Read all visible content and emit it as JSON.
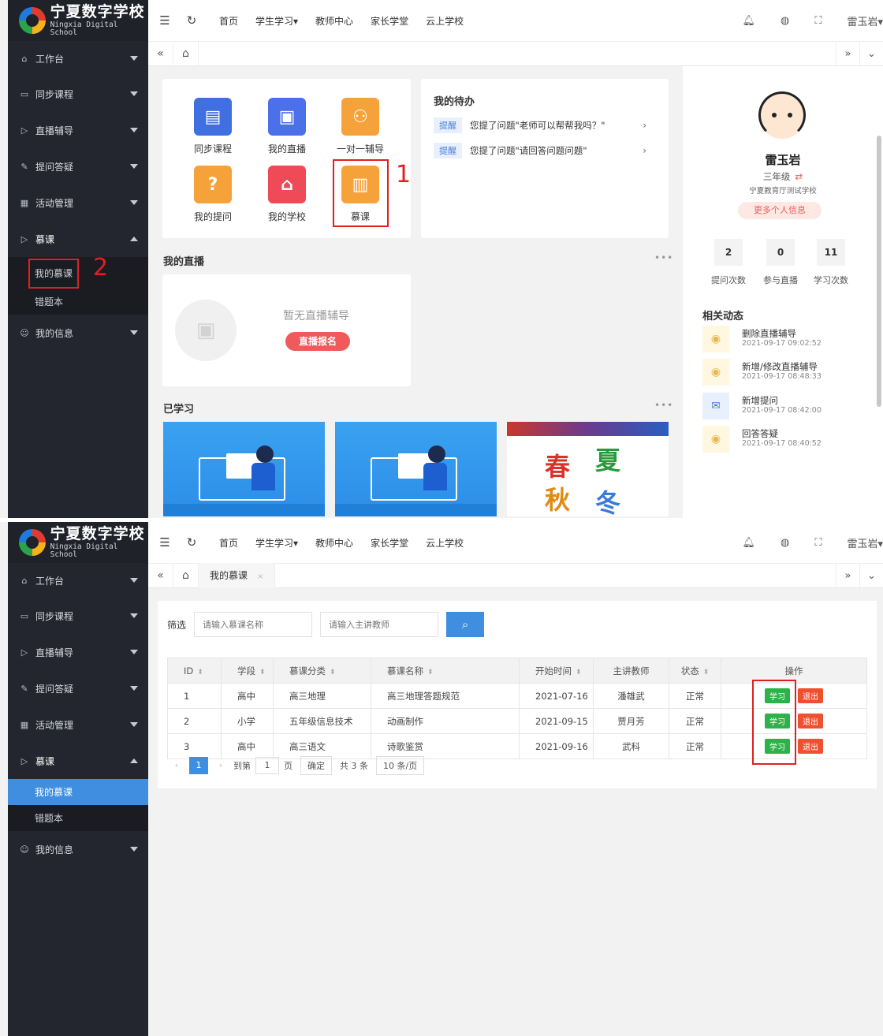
{
  "brand": {
    "name_cn": "宁夏数字学校",
    "name_en": "Ningxia Digital School"
  },
  "topnav": {
    "links": [
      "首页",
      "学生学习▾",
      "教师中心",
      "家长学堂",
      "云上学校"
    ],
    "user": "雷玉岩▾"
  },
  "sidebar": {
    "items": [
      {
        "label": "工作台",
        "icon": "home-icon"
      },
      {
        "label": "同步课程",
        "icon": "book-icon"
      },
      {
        "label": "直播辅导",
        "icon": "play-icon"
      },
      {
        "label": "提问答疑",
        "icon": "edit-icon"
      },
      {
        "label": "活动管理",
        "icon": "grid-icon"
      },
      {
        "label": "慕课",
        "icon": "play-icon"
      }
    ],
    "mooc_sub": [
      "我的慕课",
      "错题本"
    ],
    "info": "我的信息"
  },
  "shot1": {
    "apps": [
      "同步课程",
      "我的直播",
      "一对一辅导",
      "我的提问",
      "我的学校",
      "慕课"
    ],
    "todo": {
      "title": "我的待办",
      "items": [
        {
          "tag": "提醒",
          "text": "您提了问题\"老师可以帮帮我吗？\""
        },
        {
          "tag": "提醒",
          "text": "您提了问题\"请回答问题问题\""
        }
      ]
    },
    "live_title": "我的直播",
    "live_empty": "暂无直播辅导",
    "live_button": "直播报名",
    "learned_title": "已学习",
    "more_dots": "•••",
    "callout1": "1",
    "callout2": "2",
    "thumb_glyphs": [
      "春",
      "夏",
      "秋",
      "冬"
    ],
    "profile": {
      "name": "雷玉岩",
      "grade": "三年级",
      "school": "宁夏教育厅测试学校",
      "more": "更多个人信息",
      "stats": [
        {
          "value": "2",
          "label": "提问次数"
        },
        {
          "value": "0",
          "label": "参与直播"
        },
        {
          "value": "11",
          "label": "学习次数"
        }
      ],
      "related_title": "相关动态",
      "activities": [
        {
          "title": "删除直播辅导",
          "time": "2021-09-17 09:02:52",
          "icon": "eye-icon"
        },
        {
          "title": "新增/修改直播辅导",
          "time": "2021-09-17 08:48:33",
          "icon": "eye-icon"
        },
        {
          "title": "新增提问",
          "time": "2021-09-17 08:42:00",
          "icon": "mail-icon"
        },
        {
          "title": "回答答疑",
          "time": "2021-09-17 08:40:52",
          "icon": "eye-icon"
        }
      ]
    }
  },
  "shot2": {
    "tab": "我的慕课",
    "filter_label": "筛选",
    "ph_course": "请输入慕课名称",
    "ph_teacher": "请输入主讲教师",
    "headers": [
      "ID",
      "学段",
      "慕课分类",
      "慕课名称",
      "开始时间",
      "主讲教师",
      "状态",
      "操作"
    ],
    "rows": [
      [
        "1",
        "高中",
        "高三地理",
        "高三地理答题规范",
        "2021-07-16",
        "潘雄武",
        "正常"
      ],
      [
        "2",
        "小学",
        "五年级信息技术",
        "动画制作",
        "2021-09-15",
        "贾月芳",
        "正常"
      ],
      [
        "3",
        "高中",
        "高三语文",
        "诗歌鉴赏",
        "2021-09-16",
        "武科",
        "正常"
      ]
    ],
    "study": "学习",
    "exit": "退出",
    "pager": {
      "page": "1",
      "goto": "到第",
      "goto_page": "1",
      "page_unit": "页",
      "ok": "确定",
      "total": "共 3 条",
      "size": "10 条/页"
    }
  }
}
